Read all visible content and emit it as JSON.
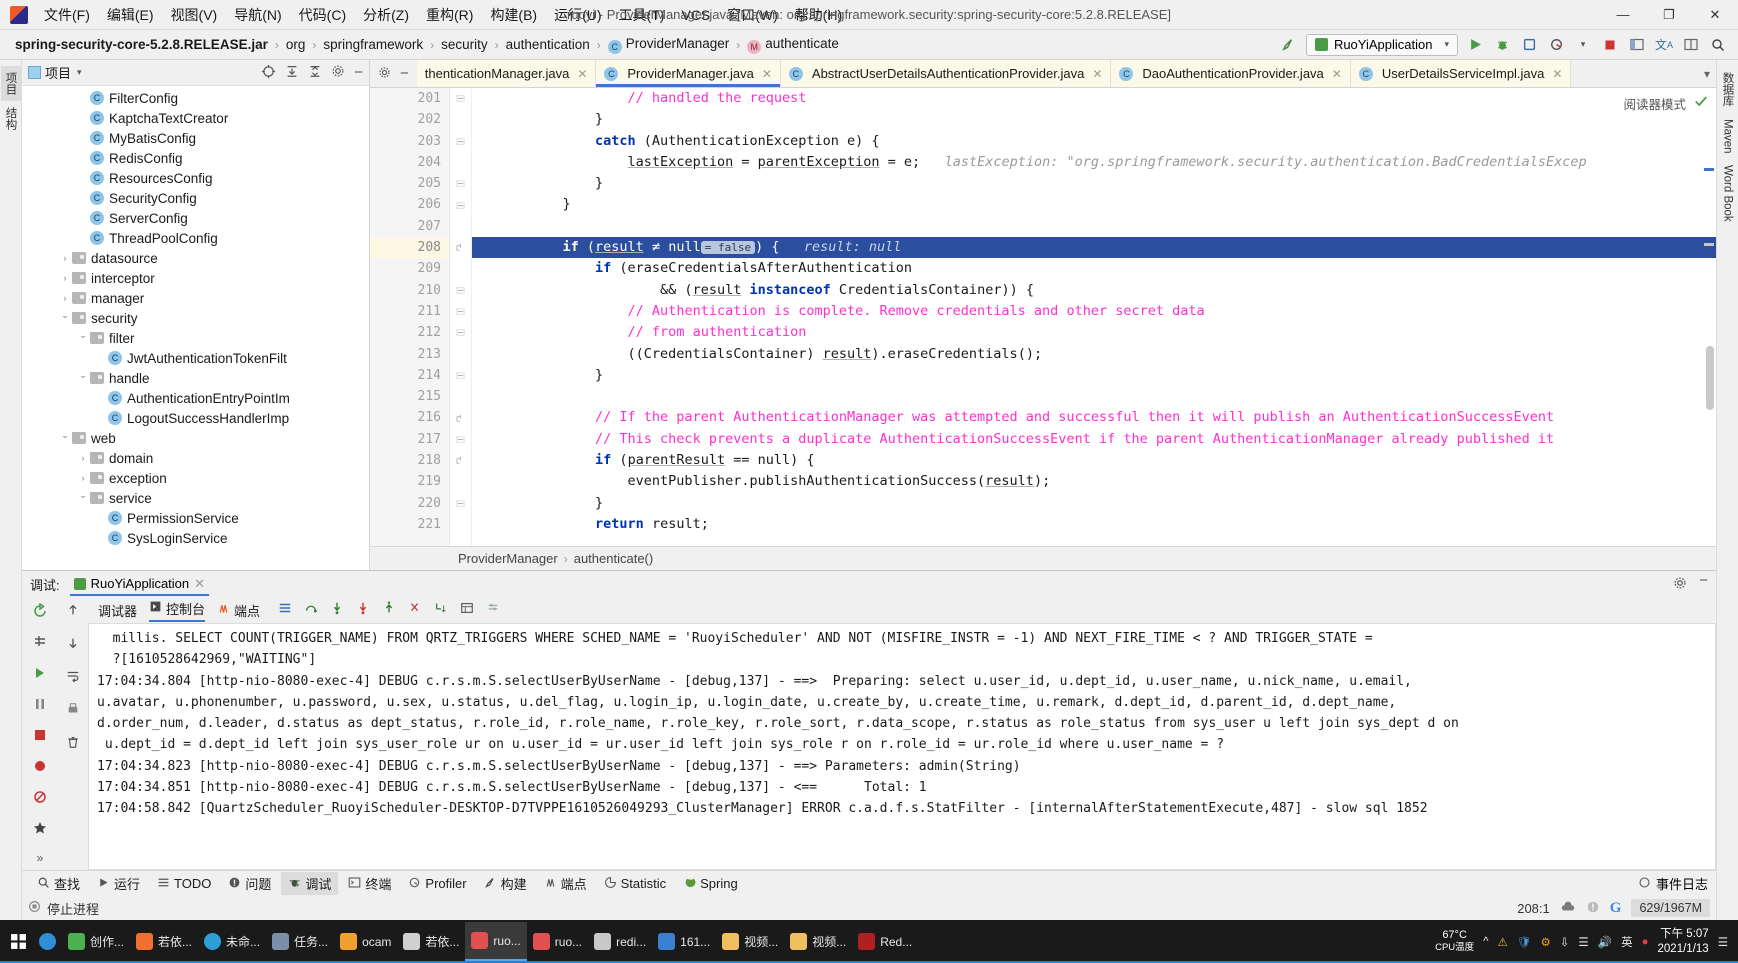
{
  "window": {
    "title": "ruoyi - ProviderManager.java [Maven: org.springframework.security:spring-security-core:5.2.8.RELEASE]",
    "minimize": "—",
    "maximize": "❐",
    "close": "✕"
  },
  "menu": [
    {
      "label": "文件(F)"
    },
    {
      "label": "编辑(E)"
    },
    {
      "label": "视图(V)"
    },
    {
      "label": "导航(N)"
    },
    {
      "label": "代码(C)"
    },
    {
      "label": "分析(Z)"
    },
    {
      "label": "重构(R)"
    },
    {
      "label": "构建(B)"
    },
    {
      "label": "运行(U)"
    },
    {
      "label": "工具(T)"
    },
    {
      "label": "VCS"
    },
    {
      "label": "窗口(W)"
    },
    {
      "label": "帮助(H)"
    }
  ],
  "breadcrumb": {
    "items": [
      {
        "label": "spring-security-core-5.2.8.RELEASE.jar",
        "icon": "",
        "bold": true
      },
      {
        "label": "org",
        "icon": ""
      },
      {
        "label": "springframework",
        "icon": ""
      },
      {
        "label": "security",
        "icon": ""
      },
      {
        "label": "authentication",
        "icon": ""
      },
      {
        "label": "ProviderManager",
        "icon": "c"
      },
      {
        "label": "authenticate",
        "icon": "m"
      }
    ]
  },
  "toolbar": {
    "build_icon": "build-icon",
    "run_config": "RuoYiApplication",
    "run": "run-icon",
    "debug": "debug-icon",
    "coverage": "coverage-icon",
    "profile": "profile-icon",
    "stop": "stop-icon",
    "search_everywhere": "search-icon",
    "translate": "translate-icon",
    "layout": "layout-icon"
  },
  "project": {
    "title": "项目",
    "actions": [
      "target-icon",
      "collapse-icon",
      "expand-icon",
      "gear-icon",
      "minimize-icon"
    ],
    "tree": [
      {
        "label": "FilterConfig",
        "type": "class",
        "depth": 4,
        "arrow": "none"
      },
      {
        "label": "KaptchaTextCreator",
        "type": "class",
        "depth": 4,
        "arrow": "none"
      },
      {
        "label": "MyBatisConfig",
        "type": "class",
        "depth": 4,
        "arrow": "none"
      },
      {
        "label": "RedisConfig",
        "type": "class",
        "depth": 4,
        "arrow": "none"
      },
      {
        "label": "ResourcesConfig",
        "type": "class",
        "depth": 4,
        "arrow": "none"
      },
      {
        "label": "SecurityConfig",
        "type": "class",
        "depth": 4,
        "arrow": "none"
      },
      {
        "label": "ServerConfig",
        "type": "class",
        "depth": 4,
        "arrow": "none"
      },
      {
        "label": "ThreadPoolConfig",
        "type": "class",
        "depth": 4,
        "arrow": "none"
      },
      {
        "label": "datasource",
        "type": "folder",
        "depth": 3,
        "arrow": "closed"
      },
      {
        "label": "interceptor",
        "type": "folder",
        "depth": 3,
        "arrow": "closed"
      },
      {
        "label": "manager",
        "type": "folder",
        "depth": 3,
        "arrow": "closed"
      },
      {
        "label": "security",
        "type": "folder",
        "depth": 3,
        "arrow": "open"
      },
      {
        "label": "filter",
        "type": "folder",
        "depth": 4,
        "arrow": "open"
      },
      {
        "label": "JwtAuthenticationTokenFilt",
        "type": "class",
        "depth": 5,
        "arrow": "none"
      },
      {
        "label": "handle",
        "type": "folder",
        "depth": 4,
        "arrow": "open"
      },
      {
        "label": "AuthenticationEntryPointIm",
        "type": "class",
        "depth": 5,
        "arrow": "none"
      },
      {
        "label": "LogoutSuccessHandlerImp",
        "type": "class",
        "depth": 5,
        "arrow": "none"
      },
      {
        "label": "web",
        "type": "folder",
        "depth": 3,
        "arrow": "open"
      },
      {
        "label": "domain",
        "type": "folder",
        "depth": 4,
        "arrow": "closed"
      },
      {
        "label": "exception",
        "type": "folder",
        "depth": 4,
        "arrow": "closed"
      },
      {
        "label": "service",
        "type": "folder",
        "depth": 4,
        "arrow": "open"
      },
      {
        "label": "PermissionService",
        "type": "class",
        "depth": 5,
        "arrow": "none"
      },
      {
        "label": "SysLoginService",
        "type": "class",
        "depth": 5,
        "arrow": "none"
      }
    ]
  },
  "editor": {
    "tabs": [
      {
        "label": "thenticationManager.java",
        "icon": "",
        "active": false
      },
      {
        "label": "ProviderManager.java",
        "icon": "c",
        "active": true
      },
      {
        "label": "AbstractUserDetailsAuthenticationProvider.java",
        "icon": "c",
        "active": false
      },
      {
        "label": "DaoAuthenticationProvider.java",
        "icon": "c",
        "active": false
      },
      {
        "label": "UserDetailsServiceImpl.java",
        "icon": "c",
        "active": false
      }
    ],
    "reader_mode": "阅读器模式",
    "first_line": 201,
    "current_line": 208,
    "lines": [
      {
        "n": 201,
        "fold": "open-end",
        "code": "            <span class=\"cm\">// handled the request</span>"
      },
      {
        "n": 202,
        "fold": "",
        "code": "        }"
      },
      {
        "n": 203,
        "fold": "end",
        "code": "        <span class=\"kw\">catch</span> (AuthenticationException e) {"
      },
      {
        "n": 204,
        "fold": "",
        "code": "            <span class=\"fld\">lastException</span> = <span class=\"fld\">parentException</span> = e;   <span class=\"hint\">lastException: \"org.springframework.security.authentication.BadCredentialsExcep</span>"
      },
      {
        "n": 205,
        "fold": "end",
        "code": "        }"
      },
      {
        "n": 206,
        "fold": "end",
        "code": "    }"
      },
      {
        "n": 207,
        "fold": "",
        "code": ""
      },
      {
        "n": 208,
        "fold": "start",
        "highlight": true,
        "code": "    <span class=\"kw\">if</span> (<span class=\"fld\">result</span> ≠ null<span class=\"inlay\">= false</span>) {   <span class=\"hint\">result: null</span>"
      },
      {
        "n": 209,
        "fold": "",
        "code": "        <span class=\"kw\">if</span> (eraseCredentialsAfterAuthentication"
      },
      {
        "n": 210,
        "fold": "end",
        "code": "                && (<span class=\"fld\">result</span> <span class=\"kw\">instanceof</span> CredentialsContainer)) {"
      },
      {
        "n": 211,
        "fold": "end",
        "code": "            <span class=\"cm\">// Authentication is complete. Remove credentials and other secret data</span>"
      },
      {
        "n": 212,
        "fold": "end",
        "code": "            <span class=\"cm\">// from authentication</span>"
      },
      {
        "n": 213,
        "fold": "",
        "code": "            ((CredentialsContainer) <span class=\"fld\">result</span>).eraseCredentials();"
      },
      {
        "n": 214,
        "fold": "end",
        "code": "        }"
      },
      {
        "n": 215,
        "fold": "",
        "code": ""
      },
      {
        "n": 216,
        "fold": "start",
        "code": "        <span class=\"cm\">// If the parent AuthenticationManager was attempted and successful then it will publish an AuthenticationSuccessEvent</span>"
      },
      {
        "n": 217,
        "fold": "end",
        "code": "        <span class=\"cm\">// This check prevents a duplicate AuthenticationSuccessEvent if the parent AuthenticationManager already published it</span>"
      },
      {
        "n": 218,
        "fold": "start",
        "code": "        <span class=\"kw\">if</span> (<span class=\"fld\">parentResult</span> == null) {"
      },
      {
        "n": 219,
        "fold": "",
        "code": "            eventPublisher.publishAuthenticationSuccess(<span class=\"fld\">result</span>);"
      },
      {
        "n": 220,
        "fold": "end",
        "code": "        }"
      },
      {
        "n": 221,
        "fold": "",
        "code": "        <span class=\"kw\">return</span> result;"
      }
    ],
    "status_crumbs": [
      "ProviderManager",
      "authenticate()"
    ]
  },
  "debug": {
    "window_label": "调试:",
    "session_tab": "RuoYiApplication",
    "tabs": [
      {
        "label": "调试器",
        "selected": false
      },
      {
        "label": "控制台",
        "selected": true
      },
      {
        "label": "端点",
        "selected": false
      }
    ],
    "toolbar_icons": [
      "menu-icon",
      "step-over-icon",
      "step-into-icon",
      "force-step-into-icon",
      "step-out-icon",
      "drop-frame-icon",
      "run-to-cursor-icon",
      "evaluate-icon",
      "settings-icon"
    ],
    "console_lines": [
      "  millis. SELECT COUNT(TRIGGER_NAME) FROM QRTZ_TRIGGERS WHERE SCHED_NAME = 'RuoyiScheduler' AND NOT (MISFIRE_INSTR = -1) AND NEXT_FIRE_TIME < ? AND TRIGGER_STATE =",
      "  ?[1610528642969,\"WAITING\"]",
      "17:04:34.804 [http-nio-8080-exec-4] DEBUG c.r.s.m.S.selectUserByUserName - [debug,137] - ==>  Preparing: select u.user_id, u.dept_id, u.user_name, u.nick_name, u.email,",
      "u.avatar, u.phonenumber, u.password, u.sex, u.status, u.del_flag, u.login_ip, u.login_date, u.create_by, u.create_time, u.remark, d.dept_id, d.parent_id, d.dept_name,",
      "d.order_num, d.leader, d.status as dept_status, r.role_id, r.role_name, r.role_key, r.role_sort, r.data_scope, r.status as role_status from sys_user u left join sys_dept d on",
      " u.dept_id = d.dept_id left join sys_user_role ur on u.user_id = ur.user_id left join sys_role r on r.role_id = ur.role_id where u.user_name = ?",
      "17:04:34.823 [http-nio-8080-exec-4] DEBUG c.r.s.m.S.selectUserByUserName - [debug,137] - ==> Parameters: admin(String)",
      "17:04:34.851 [http-nio-8080-exec-4] DEBUG c.r.s.m.S.selectUserByUserName - [debug,137] - <==      Total: 1",
      "17:04:58.842 [QuartzScheduler_RuoyiScheduler-DESKTOP-D7TVPPE1610526049293_ClusterManager] ERROR c.a.d.f.s.StatFilter - [internalAfterStatementExecute,487] - slow sql 1852"
    ]
  },
  "tool_windows": {
    "items": [
      {
        "label": "查找",
        "icon": "search-icon",
        "selected": false
      },
      {
        "label": "运行",
        "icon": "run-icon",
        "selected": false
      },
      {
        "label": "TODO",
        "icon": "todo-icon",
        "selected": false
      },
      {
        "label": "问题",
        "icon": "problems-icon",
        "selected": false
      },
      {
        "label": "调试",
        "icon": "debug-icon",
        "selected": true
      },
      {
        "label": "终端",
        "icon": "terminal-icon",
        "selected": false
      },
      {
        "label": "Profiler",
        "icon": "profiler-icon",
        "selected": false
      },
      {
        "label": "构建",
        "icon": "build-icon",
        "selected": false
      },
      {
        "label": "端点",
        "icon": "endpoints-icon",
        "selected": false
      },
      {
        "label": "Statistic",
        "icon": "statistic-icon",
        "selected": false
      },
      {
        "label": "Spring",
        "icon": "spring-icon",
        "selected": false
      }
    ],
    "event_log": "事件日志"
  },
  "status_bar": {
    "message": "停止进程",
    "caret": "208:1",
    "memory": "629/1967M"
  },
  "left_rail": [
    {
      "label": "项目",
      "selected": true
    },
    {
      "label": "结构",
      "selected": false
    }
  ],
  "right_rail": [
    {
      "label": "数据库",
      "selected": false
    },
    {
      "label": "Maven",
      "selected": false
    },
    {
      "label": "Word Book",
      "selected": false
    }
  ],
  "taskbar": {
    "items": [
      {
        "label": "",
        "icon": "start-icon",
        "color": "#ffffff",
        "active": false
      },
      {
        "label": "",
        "icon": "edge-icon",
        "color": "#2e8fd6",
        "active": false
      },
      {
        "label": "创作...",
        "icon": "app-icon",
        "color": "#4caf50",
        "active": false
      },
      {
        "label": "若依...",
        "icon": "app-icon",
        "color": "#f07030",
        "active": false
      },
      {
        "label": "未命...",
        "icon": "chrome-icon",
        "color": "#2e9fd6",
        "active": false
      },
      {
        "label": "任务...",
        "icon": "app-icon",
        "color": "#7a8fa8",
        "active": false
      },
      {
        "label": "ocam",
        "icon": "ocam-icon",
        "color": "#f0a030",
        "active": false
      },
      {
        "label": "若依...",
        "icon": "app-icon",
        "color": "#d0d0d0",
        "active": false
      },
      {
        "label": "ruo...",
        "icon": "idea-icon",
        "color": "#e05050",
        "active": true
      },
      {
        "label": "ruo...",
        "icon": "idea-icon",
        "color": "#e05050",
        "active": false
      },
      {
        "label": "redi...",
        "icon": "app-icon",
        "color": "#c8c8c8",
        "active": false
      },
      {
        "label": "161...",
        "icon": "wps-icon",
        "color": "#3a7fd0",
        "active": false
      },
      {
        "label": "视频...",
        "icon": "folder-icon",
        "color": "#f0c060",
        "active": false
      },
      {
        "label": "视频...",
        "icon": "folder-icon",
        "color": "#f0c060",
        "active": false
      },
      {
        "label": "Red...",
        "icon": "app-icon",
        "color": "#b02020",
        "active": false
      }
    ],
    "cpu_temp": "67°C",
    "cpu_label": "CPU温度",
    "tray_icons": [
      "chevron-up-icon",
      "warning-icon",
      "shield-icon",
      "gear-icon",
      "download-icon",
      "battery-icon",
      "network-icon",
      "volume-icon"
    ],
    "ime": "英",
    "time": "下午 5:07",
    "date": "2021/1/13"
  }
}
